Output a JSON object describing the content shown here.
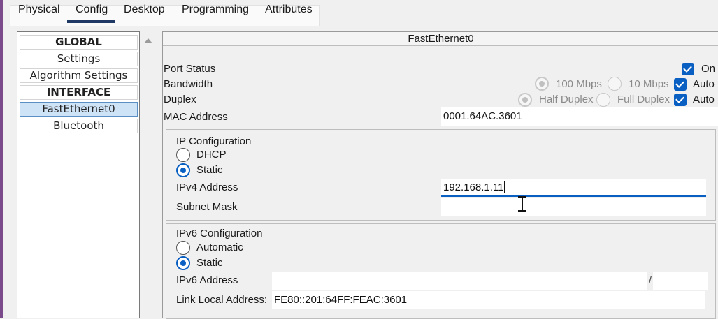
{
  "tabs": [
    {
      "label": "Physical",
      "active": false
    },
    {
      "label": "Config",
      "active": true
    },
    {
      "label": "Desktop",
      "active": false
    },
    {
      "label": "Programming",
      "active": false
    },
    {
      "label": "Attributes",
      "active": false
    }
  ],
  "sidebar": {
    "items": [
      {
        "label": "GLOBAL",
        "kind": "header"
      },
      {
        "label": "Settings",
        "kind": "item"
      },
      {
        "label": "Algorithm Settings",
        "kind": "item"
      },
      {
        "label": "INTERFACE",
        "kind": "header"
      },
      {
        "label": "FastEthernet0",
        "kind": "item",
        "selected": true
      },
      {
        "label": "Bluetooth",
        "kind": "item"
      }
    ]
  },
  "panel": {
    "title": "FastEthernet0",
    "port_status": {
      "label": "Port Status",
      "on_label": "On",
      "checked": true
    },
    "bandwidth": {
      "label": "Bandwidth",
      "option_100": "100 Mbps",
      "option_10": "10 Mbps",
      "auto_label": "Auto",
      "auto_checked": true
    },
    "duplex": {
      "label": "Duplex",
      "option_half": "Half Duplex",
      "option_full": "Full Duplex",
      "auto_label": "Auto",
      "auto_checked": true
    },
    "mac": {
      "label": "MAC Address",
      "value": "0001.64AC.3601"
    },
    "ipv4_config": {
      "title": "IP Configuration",
      "dhcp_label": "DHCP",
      "static_label": "Static",
      "selected": "Static",
      "ipv4_label": "IPv4 Address",
      "ipv4_value": "192.168.1.11",
      "mask_label": "Subnet Mask",
      "mask_value": ""
    },
    "ipv6_config": {
      "title": "IPv6 Configuration",
      "automatic_label": "Automatic",
      "static_label": "Static",
      "selected": "Static",
      "ipv6_label": "IPv6 Address",
      "ipv6_value": "",
      "prefix_separator": "/",
      "prefix_value": "",
      "link_local_label": "Link Local Address:",
      "link_local_value": "FE80::201:64FF:FEAC:3601"
    }
  },
  "colors": {
    "accent": "#0a5fc2",
    "selected_bg": "#cfe3f7",
    "tab_indicator": "#1f3864"
  },
  "icons": {
    "scroll_up": "triangle-up-icon",
    "checkbox": "checkmark-icon",
    "cursor": "text-cursor-icon"
  }
}
